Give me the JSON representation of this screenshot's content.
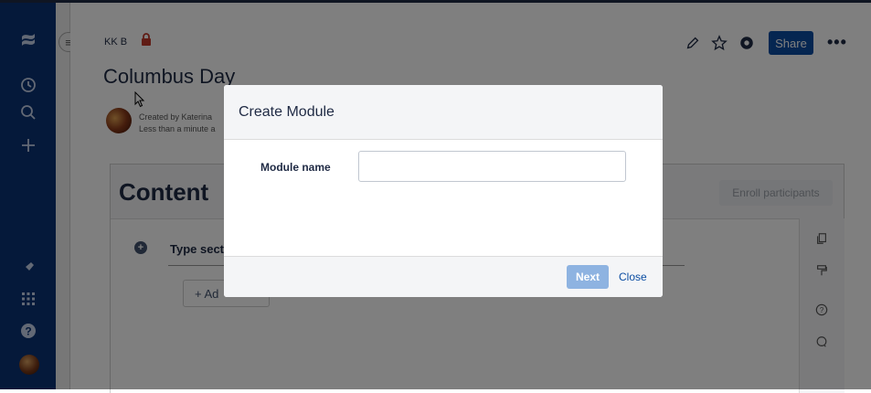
{
  "app": {
    "breadcrumb": "KK B",
    "share_label": "Share",
    "more_label": "•••"
  },
  "page": {
    "title": "Columbus Day",
    "meta_created": "Created by Katerina",
    "meta_time": "Less than a minute a"
  },
  "content_panel": {
    "heading": "Content",
    "enroll_label": "Enroll participants",
    "section_placeholder": "Type sect",
    "add_label": "+ Ad"
  },
  "modal": {
    "title": "Create Module",
    "field_label": "Module name",
    "field_value": "",
    "field_placeholder": "",
    "next_label": "Next",
    "close_label": "Close"
  },
  "colors": {
    "sidebar": "#0b3274",
    "accent": "#0b4da2",
    "next_disabled": "#8eb3e1",
    "restriction_lock": "#c0392b"
  },
  "icons": {
    "sidebar": [
      "confluence-logo-icon",
      "recent-icon",
      "search-icon",
      "create-icon",
      "pin-icon",
      "app-switcher-icon",
      "help-icon",
      "profile-avatar"
    ],
    "toolbar": [
      "edit-icon",
      "star-icon",
      "watch-icon"
    ],
    "rightbar": [
      "copy-icon",
      "roller-icon",
      "help-circle-icon",
      "comment-icon"
    ]
  }
}
